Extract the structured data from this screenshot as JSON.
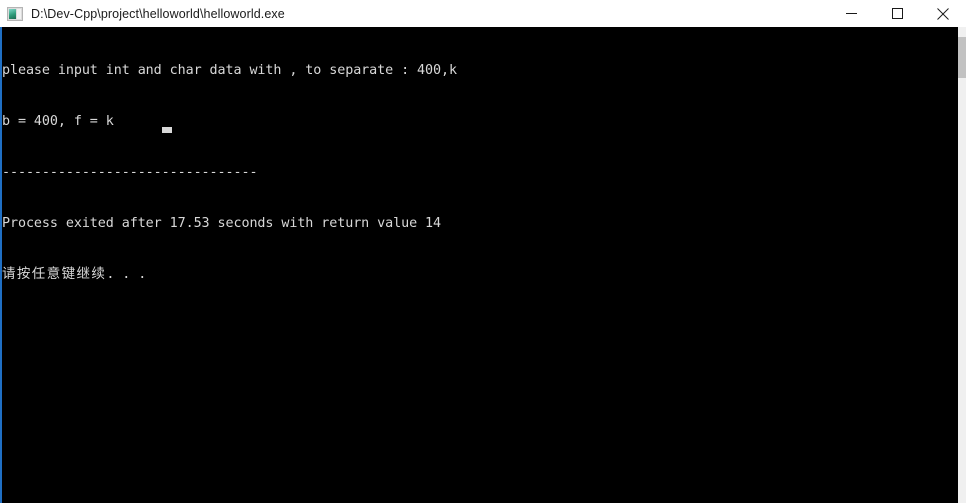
{
  "window": {
    "title": "D:\\Dev-Cpp\\project\\helloworld\\helloworld.exe",
    "icon": "console-app-icon",
    "titlebar_background": "#ffffff",
    "title_color": "#1a1a1a",
    "console_background": "#000000",
    "console_text_color": "#d8d8d8",
    "left_border_color": "#1f6fc4"
  },
  "controls": {
    "minimize_label": "─",
    "maximize_label": "□",
    "close_label": "✕",
    "minimize_name": "minimize-button",
    "maximize_name": "maximize-button",
    "close_name": "close-button"
  },
  "console": {
    "lines": [
      "please input int and char data with , to separate : 400,k",
      "b = 400, f = k",
      "--------------------------------",
      "Process exited after 17.53 seconds with return value 14"
    ],
    "line1": "please input int and char data with , to separate : 400,k",
    "line2": "b = 400, f = k",
    "separator": "--------------------------------",
    "exit_line": "Process exited after 17.53 seconds with return value 14",
    "prompt_cjk": "请按任意键继续",
    "prompt_dots": ". . .",
    "exit_seconds": "17.53",
    "return_value": "14",
    "input_echo": "400,k",
    "var_b": "400",
    "var_f": "k",
    "cursor": "block-cursor"
  },
  "scrollbar": {
    "name": "vertical-scrollbar",
    "track_color": "#f0f0f0",
    "thumb_color": "#c2c2c2"
  }
}
